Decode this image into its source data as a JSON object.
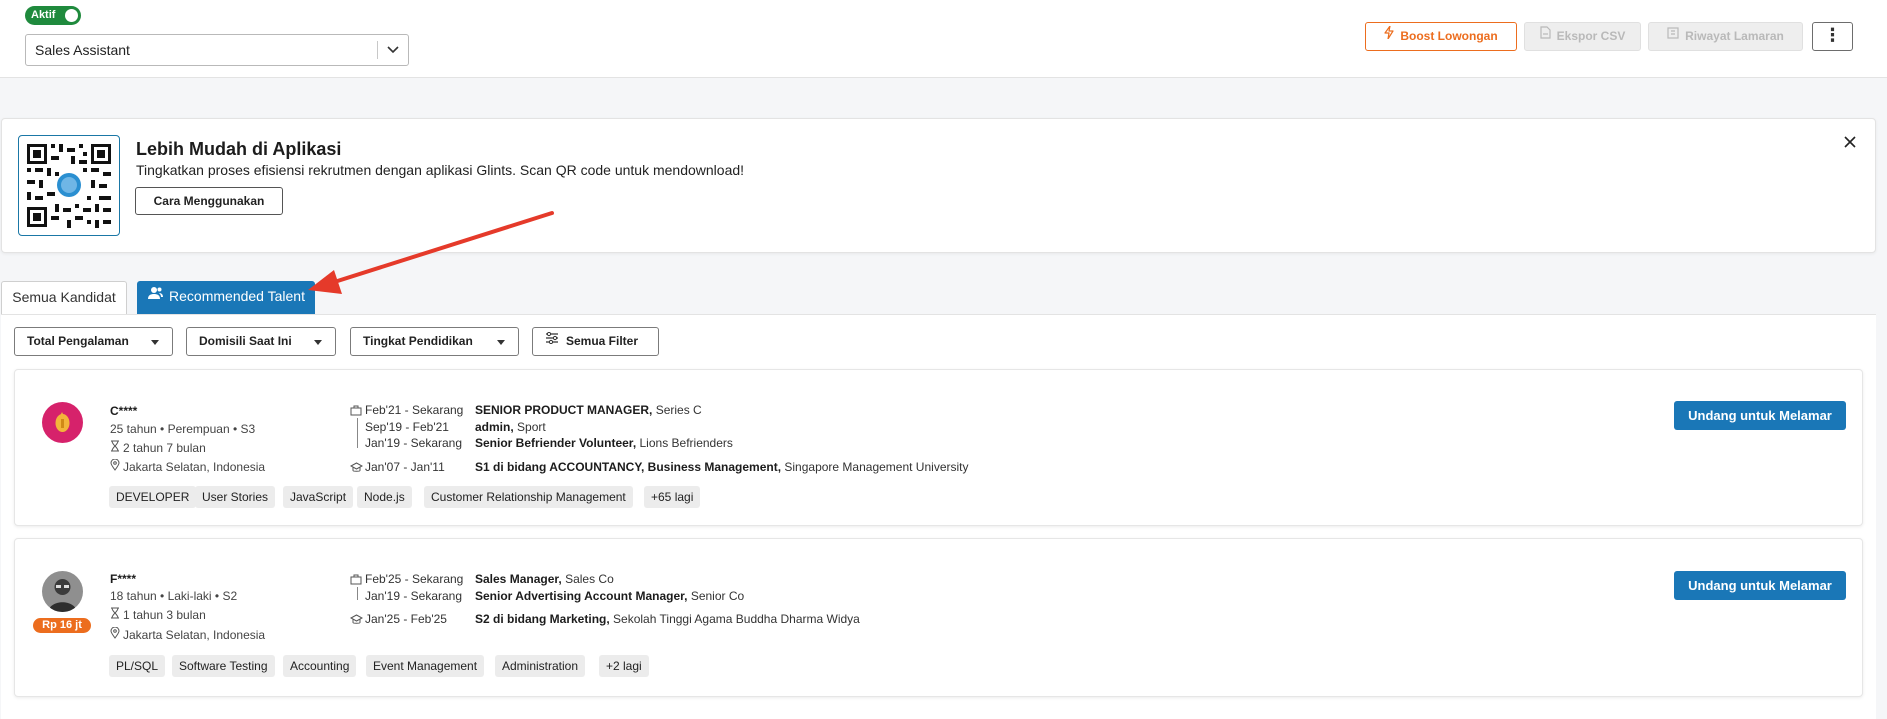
{
  "header": {
    "status_badge": "Aktif",
    "job_select_value": "Sales Assistant",
    "boost_label": "Boost Lowongan",
    "ekspor_label": "Ekspor CSV",
    "riwayat_label": "Riwayat Lamaran",
    "more_label": "⋮"
  },
  "banner": {
    "title": "Lebih Mudah di Aplikasi",
    "description": "Tingkatkan proses efisiensi rekrutmen dengan aplikasi Glints. Scan QR code untuk mendownload!",
    "button_label": "Cara Menggunakan"
  },
  "tabs": {
    "all_label": "Semua Kandidat",
    "recommended_label": "Recommended Talent"
  },
  "filters": {
    "experience": "Total Pengalaman",
    "domicile": "Domisili Saat Ini",
    "education": "Tingkat Pendidikan",
    "all": "Semua Filter"
  },
  "candidates": [
    {
      "name": "C****",
      "meta": "25 tahun • Perempuan • S3",
      "experience_total": "2 tahun 7 bulan",
      "location": "Jakarta Selatan, Indonesia",
      "salary": "",
      "work": [
        {
          "date": "Feb'21 - Sekarang",
          "title": "SENIOR PRODUCT MANAGER,",
          "company": "Series C"
        },
        {
          "date": "Sep'19 - Feb'21",
          "title": "admin,",
          "company": "Sport"
        },
        {
          "date": "Jan'19 - Sekarang",
          "title": "Senior Befriender Volunteer,",
          "company": "Lions Befrienders"
        }
      ],
      "education": {
        "date": "Jan'07 - Jan'11",
        "title": "S1 di bidang ACCOUNTANCY, Business Management,",
        "school": "Singapore Management University"
      },
      "skills": [
        "DEVELOPER",
        "User Stories",
        "JavaScript",
        "Node.js",
        "Customer Relationship Management",
        "+65 lagi"
      ],
      "invite_label": "Undang untuk Melamar"
    },
    {
      "name": "F****",
      "meta": "18 tahun • Laki-laki • S2",
      "experience_total": "1 tahun 3 bulan",
      "location": "Jakarta Selatan, Indonesia",
      "salary": "Rp 16 jt",
      "work": [
        {
          "date": "Feb'25 - Sekarang",
          "title": "Sales Manager,",
          "company": "Sales Co"
        },
        {
          "date": "Jan'19 - Sekarang",
          "title": "Senior Advertising Account Manager,",
          "company": "Senior Co"
        }
      ],
      "education": {
        "date": "Jan'25 - Feb'25",
        "title": "S2 di bidang Marketing,",
        "school": "Sekolah Tinggi Agama Buddha Dharma Widya"
      },
      "skills": [
        "PL/SQL",
        "Software Testing",
        "Accounting",
        "Event Management",
        "Administration",
        "+2 lagi"
      ],
      "invite_label": "Undang untuk Melamar"
    }
  ],
  "colors": {
    "accent_blue": "#1a77b7",
    "boost_orange": "#ec6d1e",
    "status_green": "#1f8a3d",
    "annotation_red": "#e53a2a"
  }
}
